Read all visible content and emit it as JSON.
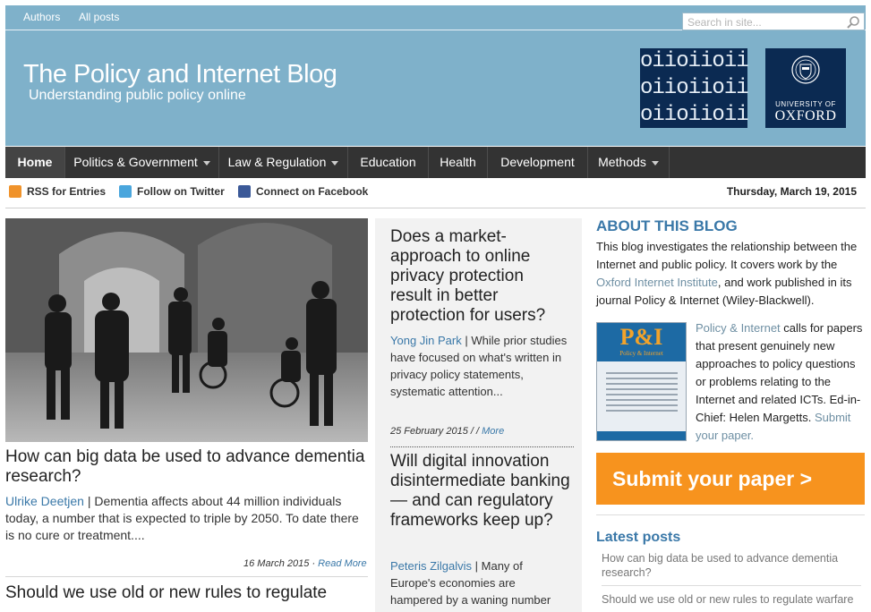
{
  "topbar": {
    "links": [
      "Authors",
      "All posts"
    ],
    "search_placeholder": "Search in site..."
  },
  "header": {
    "title": "The Policy and Internet Blog",
    "tagline": "Understanding public policy online",
    "binary_logo_rows": [
      "oiioiioii",
      "oiioiioii",
      "oiioiioii"
    ],
    "oxford_logo_small": "UNIVERSITY OF",
    "oxford_logo_big": "OXFORD"
  },
  "nav": {
    "items": [
      {
        "label": "Home",
        "active": true,
        "dropdown": false
      },
      {
        "label": "Politics & Government",
        "dropdown": true
      },
      {
        "label": "Law & Regulation",
        "dropdown": true
      },
      {
        "label": "Education",
        "dropdown": false
      },
      {
        "label": "Health",
        "dropdown": false
      },
      {
        "label": "Development",
        "dropdown": false
      },
      {
        "label": "Methods",
        "dropdown": true
      }
    ]
  },
  "social": {
    "rss": "RSS for Entries",
    "twitter": "Follow on Twitter",
    "facebook": "Connect on Facebook",
    "date": "Thursday, March 19, 2015"
  },
  "featured": {
    "title": "How can big data be used to advance dementia research?",
    "author": "Ulrike Deetjen",
    "excerpt": " | Dementia affects about 44 million individuals today, a number that is expected to triple by 2050. To date there is no cure or treatment....",
    "date": "16 March 2015",
    "more": "Read More",
    "next_title": "Should we use old or new rules to regulate"
  },
  "middle": {
    "posts": [
      {
        "title": "Does a market-approach to online privacy protection result in better protection for users?",
        "author": "Yong Jin Park",
        "excerpt": " | While prior studies have focused on what's written in privacy policy statements, systematic attention...",
        "date": "25 February 2015",
        "more": "More"
      },
      {
        "title": "Will digital innovation disintermediate banking — and can regulatory frameworks keep up?",
        "author": "Peteris Zilgalvis",
        "excerpt": " | Many of Europe's economies are hampered by a waning number"
      }
    ]
  },
  "sidebar": {
    "about_heading": "ABOUT THIS BLOG",
    "about_1": "This blog investigates the relationship between the Internet and public policy. It covers work by the ",
    "about_link": "Oxford Internet Institute",
    "about_2": ", and work published in its journal Policy & Internet (Wiley-Blackwell).",
    "journal_cover_title": "P&I",
    "journal_cover_sub": "Policy & Internet",
    "journal_link": "Policy & Internet",
    "journal_text": " calls for papers that present genuinely new approaches to policy questions or problems relating to the Internet and related ICTs. Ed-in-Chief: Helen Margetts. ",
    "submit_link": "Submit your paper.",
    "submit_button": "Submit your paper >",
    "latest_heading": "Latest posts",
    "latest_posts": [
      "How can big data be used to advance dementia research?",
      "Should we use old or new rules to regulate warfare"
    ]
  },
  "colors": {
    "header_blue": "#7fb1ca",
    "nav_dark": "#333333",
    "link_blue": "#3a78a8",
    "accent_orange": "#f7931e",
    "oxford_navy": "#0b2a52"
  }
}
